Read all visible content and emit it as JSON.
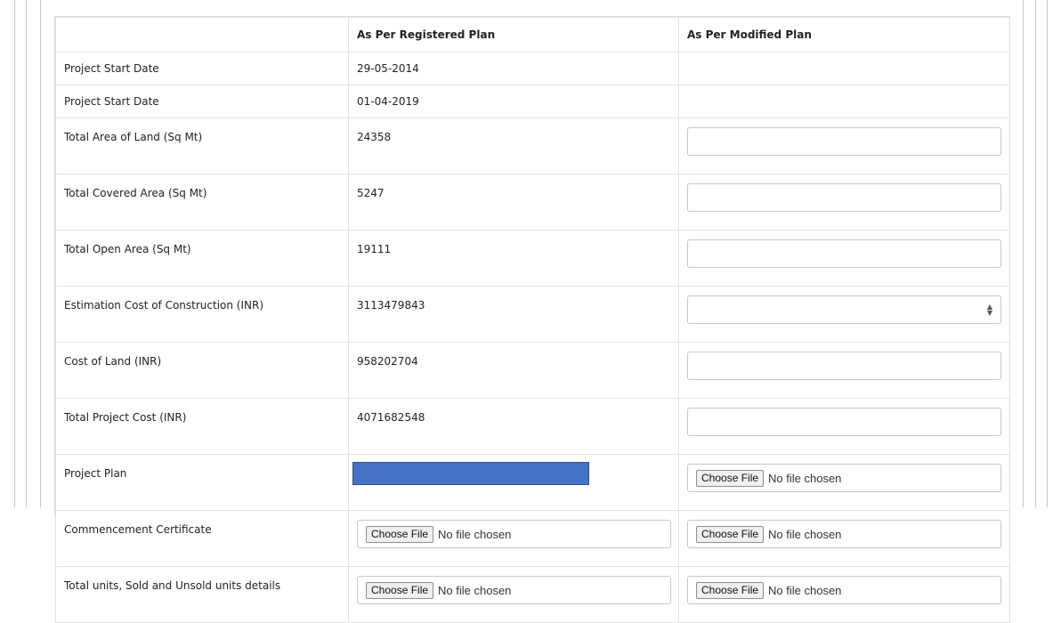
{
  "table": {
    "headers": [
      "",
      "As Per Registered Plan",
      "As Per Modified Plan"
    ],
    "rows": [
      {
        "label": "Project Start Date",
        "registered": "29-05-2014"
      },
      {
        "label": "Project Start Date",
        "registered": "01-04-2019"
      },
      {
        "label": "Total Area of Land (Sq Mt)",
        "registered": "24358",
        "modified": ""
      },
      {
        "label": "Total Covered Area (Sq Mt)",
        "registered": "5247",
        "modified": ""
      },
      {
        "label": "Total Open Area (Sq Mt)",
        "registered": "19111",
        "modified": ""
      },
      {
        "label": "Estimation Cost of Construction (INR)",
        "registered": "3113479843",
        "modified": ""
      },
      {
        "label": "Cost of Land (INR)",
        "registered": "958202704",
        "modified": ""
      },
      {
        "label": "Total Project Cost (INR)",
        "registered": "4071682548",
        "modified": ""
      },
      {
        "label": "Project Plan"
      },
      {
        "label": "Commencement Certificate"
      },
      {
        "label": "Total units, Sold and Unsold units details"
      }
    ]
  },
  "file_input": {
    "button_label": "Choose File",
    "status": "No file chosen"
  },
  "colors": {
    "redaction": "#4472c4"
  },
  "icons": {
    "number_spinner": "up-down-arrows-icon"
  }
}
